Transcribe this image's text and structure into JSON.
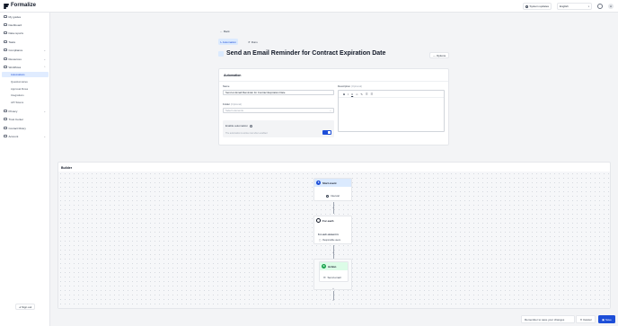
{
  "app": {
    "name": "Formalize"
  },
  "topbar": {
    "system_updates": "System updates",
    "language": "English",
    "avatar_initial": "A"
  },
  "sidebar": {
    "items": [
      {
        "label": "My guides",
        "icon": "book-icon"
      },
      {
        "label": "Dashboard",
        "icon": "dashboard-icon"
      },
      {
        "label": "Data reports",
        "icon": "report-icon"
      },
      {
        "label": "Tasks",
        "icon": "tasks-icon"
      },
      {
        "label": "Compliance",
        "icon": "shield-icon",
        "expandable": true
      },
      {
        "label": "Resources",
        "icon": "folder-icon",
        "expandable": true
      },
      {
        "label": "Workflows",
        "icon": "workflow-icon",
        "expandable": true,
        "expanded": true
      }
    ],
    "workflow_sub": [
      "Automations",
      "Questionnaires",
      "Approval Flows",
      "Integrations",
      "API Tokens"
    ],
    "active_sub": "Automations",
    "items_bottom": [
      {
        "label": "Privacy",
        "icon": "lock-icon",
        "expandable": true
      },
      {
        "label": "Trust Center",
        "icon": "trust-icon"
      },
      {
        "label": "Contact library",
        "icon": "contacts-icon"
      },
      {
        "label": "Account",
        "icon": "account-icon",
        "expandable": true
      }
    ],
    "sign_out": "Sign out"
  },
  "header": {
    "back": "Back",
    "tabs": [
      "Automation",
      "Runs"
    ],
    "active_tab": "Automation",
    "title": "Send an Email Reminder for Contract Expiration Date",
    "options": "Options"
  },
  "automation_card": {
    "title": "Automation",
    "name_label": "Name",
    "name_value": "Send an Email Reminder for Contract Expiration Date",
    "folder_label": "Folder",
    "folder_optional": "(Optional)",
    "folder_placeholder": "Select elements",
    "description_label": "Description",
    "description_optional": "(Optional)",
    "toolbar": [
      "B",
      "I",
      "U",
      "∞",
      "✎",
      "☰",
      "☰"
    ],
    "enable_label": "Enable automation",
    "enable_desc": "The automation is active now when enabled",
    "enabled": true
  },
  "builder": {
    "title": "Builder",
    "nodes": [
      {
        "type": "start",
        "title": "Start event",
        "badge": "S",
        "row": "Interval"
      },
      {
        "type": "loop",
        "title": "For each",
        "sub": "For each element in:",
        "row": "Responsible users"
      },
      {
        "type": "action",
        "title": "Action",
        "row": "Send email"
      }
    ]
  },
  "bottom_bar": {
    "message": "Remember to save your changes",
    "cancel": "Cancel",
    "save": "Save"
  },
  "colors": {
    "accent": "#1d4ed8",
    "accent_light": "#dbeafe",
    "action_green": "#dcfce7"
  }
}
